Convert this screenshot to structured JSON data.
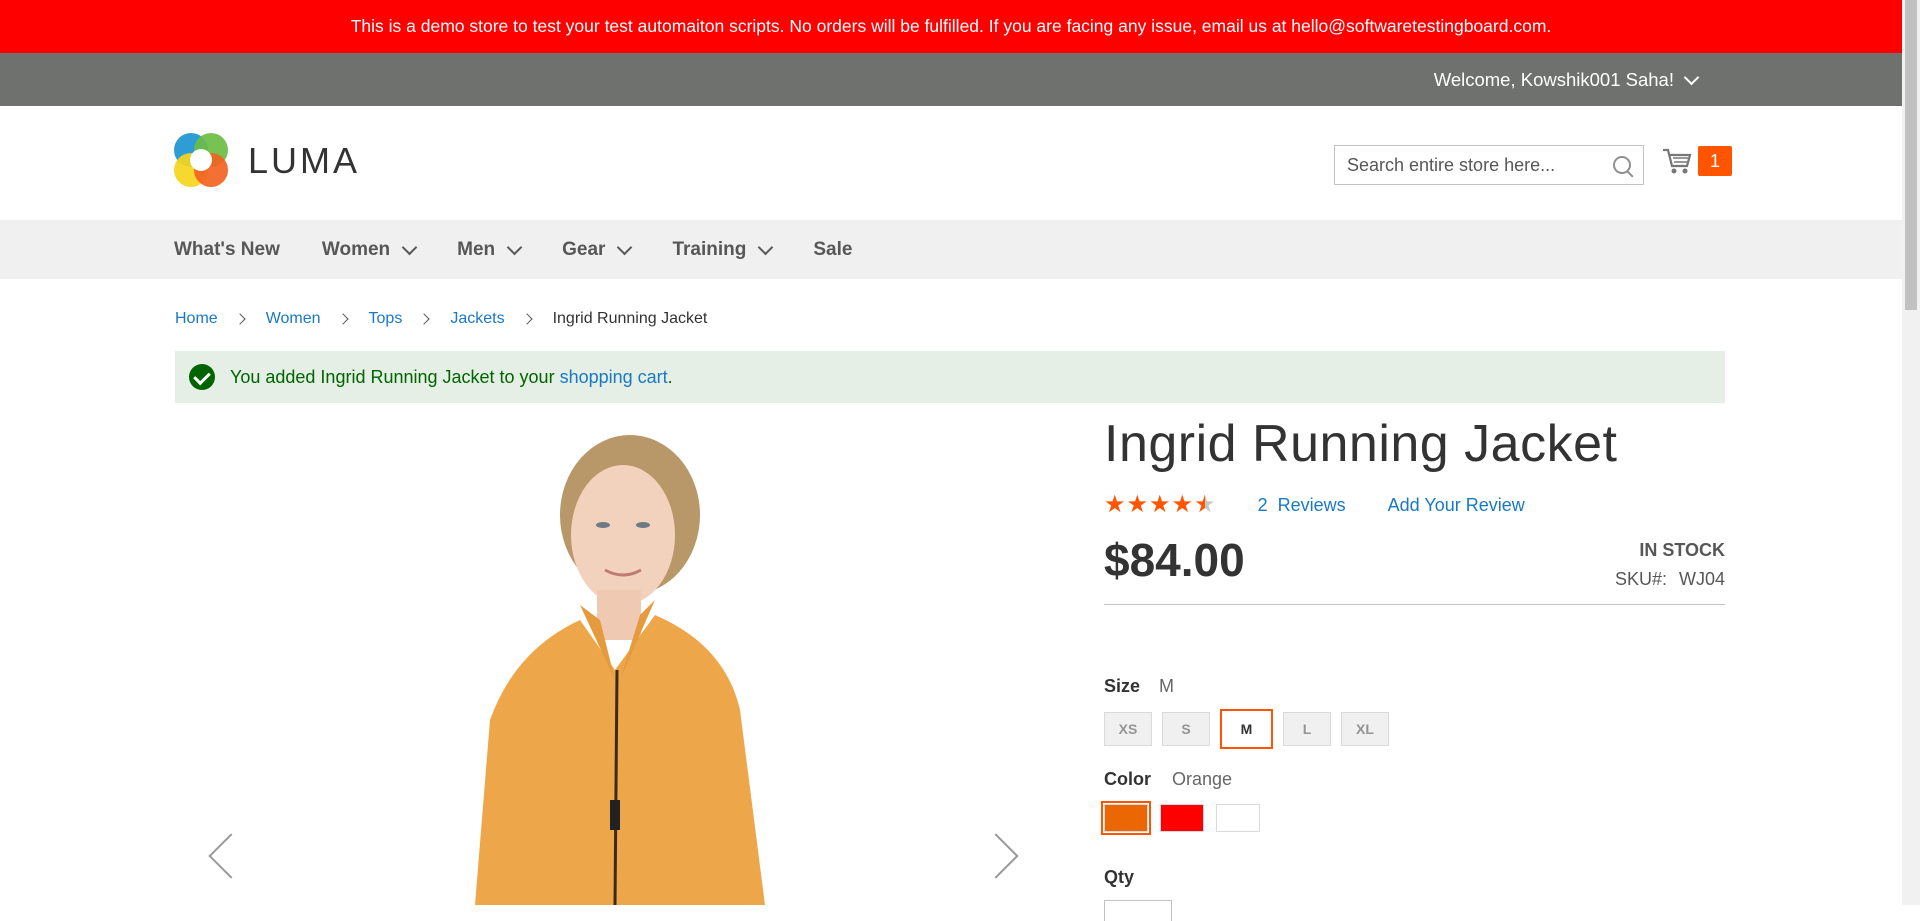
{
  "demo_notice": "This is a demo store to test your test automaiton scripts. No orders will be fulfilled. If you are facing any issue, email us at hello@softwaretestingboard.com.",
  "header": {
    "welcome": "Welcome, Kowshik001 Saha!",
    "logo_text": "LUMA",
    "search_placeholder": "Search entire store here...",
    "cart_count": "1"
  },
  "nav": {
    "items": [
      {
        "label": "What's New"
      },
      {
        "label": "Women"
      },
      {
        "label": "Men"
      },
      {
        "label": "Gear"
      },
      {
        "label": "Training"
      },
      {
        "label": "Sale"
      }
    ]
  },
  "breadcrumbs": {
    "items": [
      "Home",
      "Women",
      "Tops",
      "Jackets"
    ],
    "current": "Ingrid Running Jacket"
  },
  "message": {
    "prefix": "You added Ingrid Running Jacket to your ",
    "link": "shopping cart",
    "suffix": "."
  },
  "product": {
    "title": "Ingrid Running Jacket",
    "rating_stars": 4.5,
    "reviews_count": "2",
    "reviews_label": "Reviews",
    "add_review": "Add Your Review",
    "price": "$84.00",
    "stock": "IN STOCK",
    "sku_label": "SKU#:",
    "sku": "WJ04",
    "size_label": "Size",
    "size_selected": "M",
    "sizes": [
      "XS",
      "S",
      "M",
      "L",
      "XL"
    ],
    "color_label": "Color",
    "color_selected": "Orange",
    "colors": [
      "#eb6703",
      "#ff0000",
      "#ffffff"
    ],
    "qty_label": "Qty"
  },
  "colors": {
    "notice_bar": "#ff0000",
    "top_strip": "#6e716e",
    "accent": "#ff5501",
    "link": "#1979c3",
    "success_bg": "#e5efe5",
    "success_text": "#006400"
  }
}
